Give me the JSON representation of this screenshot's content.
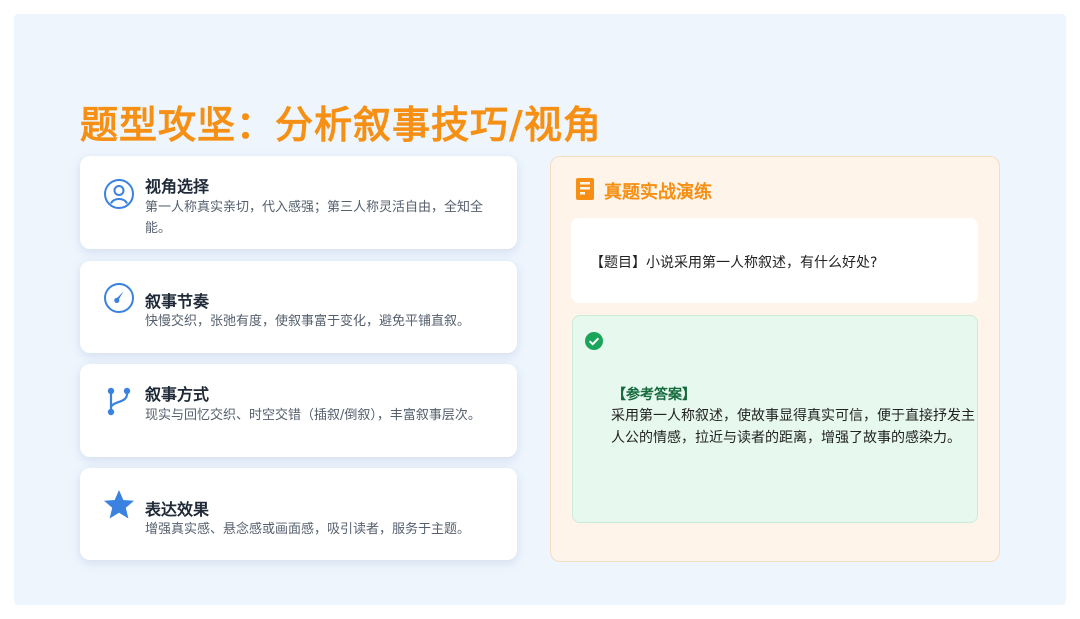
{
  "title": "题型攻坚：分析叙事技巧/视角",
  "cards": [
    {
      "icon": "user-circle-icon",
      "title": "视角选择",
      "desc": "第一人称真实亲切，代入感强；第三人称灵活自由，全知全能。"
    },
    {
      "icon": "gauge-icon",
      "title": "叙事节奏",
      "desc": "快慢交织，张弛有度，使叙事富于变化，避免平铺直叙。"
    },
    {
      "icon": "branch-icon",
      "title": "叙事方式",
      "desc": "现实与回忆交织、时空交错（插叙/倒叙），丰富叙事层次。"
    },
    {
      "icon": "star-icon",
      "title": "表达效果",
      "desc": "增强真实感、悬念感或画面感，吸引读者，服务于主题。"
    }
  ],
  "practice": {
    "icon": "document-icon",
    "title": "真题实战演练",
    "question": "【题目】小说采用第一人称叙述，有什么好处?",
    "answer_icon": "check-circle-icon",
    "answer_label": "【参考答案】",
    "answer_text": "采用第一人称叙述，使故事显得真实可信，便于直接抒发主人公的情感，拉近与读者的距离，增强了故事的感染力。"
  },
  "colors": {
    "accent": "#f59014",
    "icon_blue": "#3b82e0",
    "answer_green": "#1aa55a",
    "background": "#eef5fd"
  }
}
